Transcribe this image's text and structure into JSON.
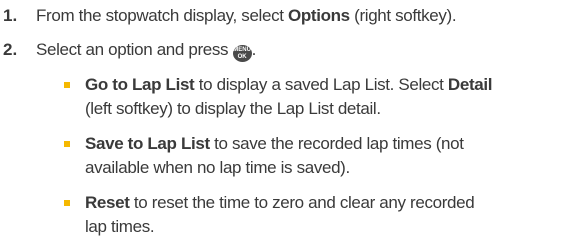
{
  "steps": [
    {
      "number": "1.",
      "prefix": "From the stopwatch display, select ",
      "bold": "Options",
      "suffix": " (right softkey)."
    },
    {
      "number": "2.",
      "prefix": "Select an option and press ",
      "key_icon": "menu-ok-key-icon",
      "key_top": "MENU",
      "key_bottom": "OK",
      "suffix": "."
    }
  ],
  "options": [
    {
      "bold": "Go to Lap List",
      "line1": " to display a saved Lap List. Select ",
      "bold2": "Detail",
      "line2": "(left softkey) to display the Lap List detail."
    },
    {
      "bold": "Save to Lap List",
      "line1": " to save the recorded lap times (not",
      "line2": "available when no lap time is saved)."
    },
    {
      "bold": "Reset",
      "line1": " to reset the time to zero and clear any recorded",
      "line2": "lap times."
    }
  ],
  "colors": {
    "text": "#3a3a3a",
    "bullet": "#f5b800",
    "key": "#4a4a4a"
  }
}
